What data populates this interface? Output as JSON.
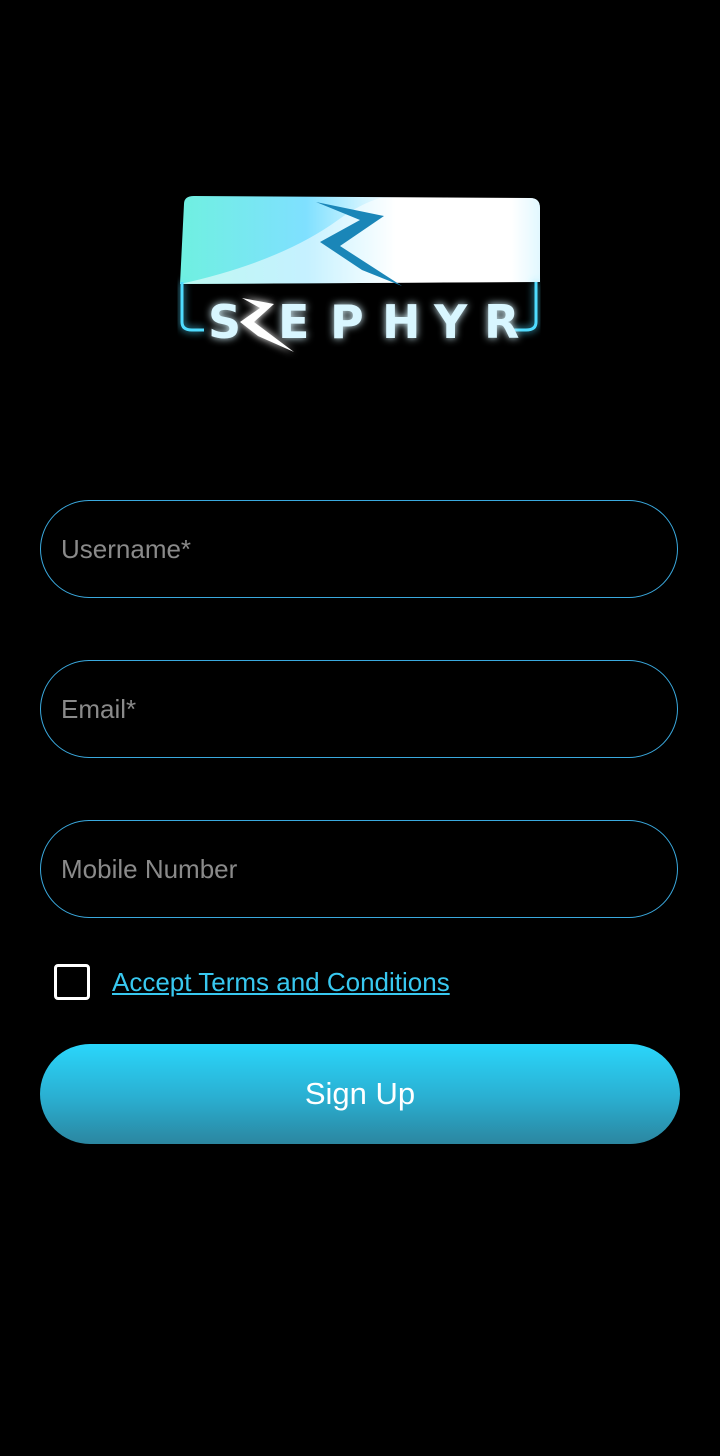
{
  "logo": {
    "text": "SZEPHYR",
    "colors": {
      "cyan": "#4fdcff",
      "teal": "#6ff0e0",
      "bolt": "#1a86b8"
    }
  },
  "form": {
    "username_placeholder": "Username*",
    "email_placeholder": "Email*",
    "mobile_placeholder": "Mobile Number",
    "username_value": "",
    "email_value": "",
    "mobile_value": ""
  },
  "terms": {
    "checked": false,
    "link_label": "Accept Terms and Conditions"
  },
  "signup": {
    "label": "Sign Up"
  },
  "colors": {
    "background": "#000000",
    "field_border": "#3aa9de",
    "accent": "#38c8f0",
    "button_top": "#2ad6fb",
    "button_bottom": "#2b86a0"
  }
}
